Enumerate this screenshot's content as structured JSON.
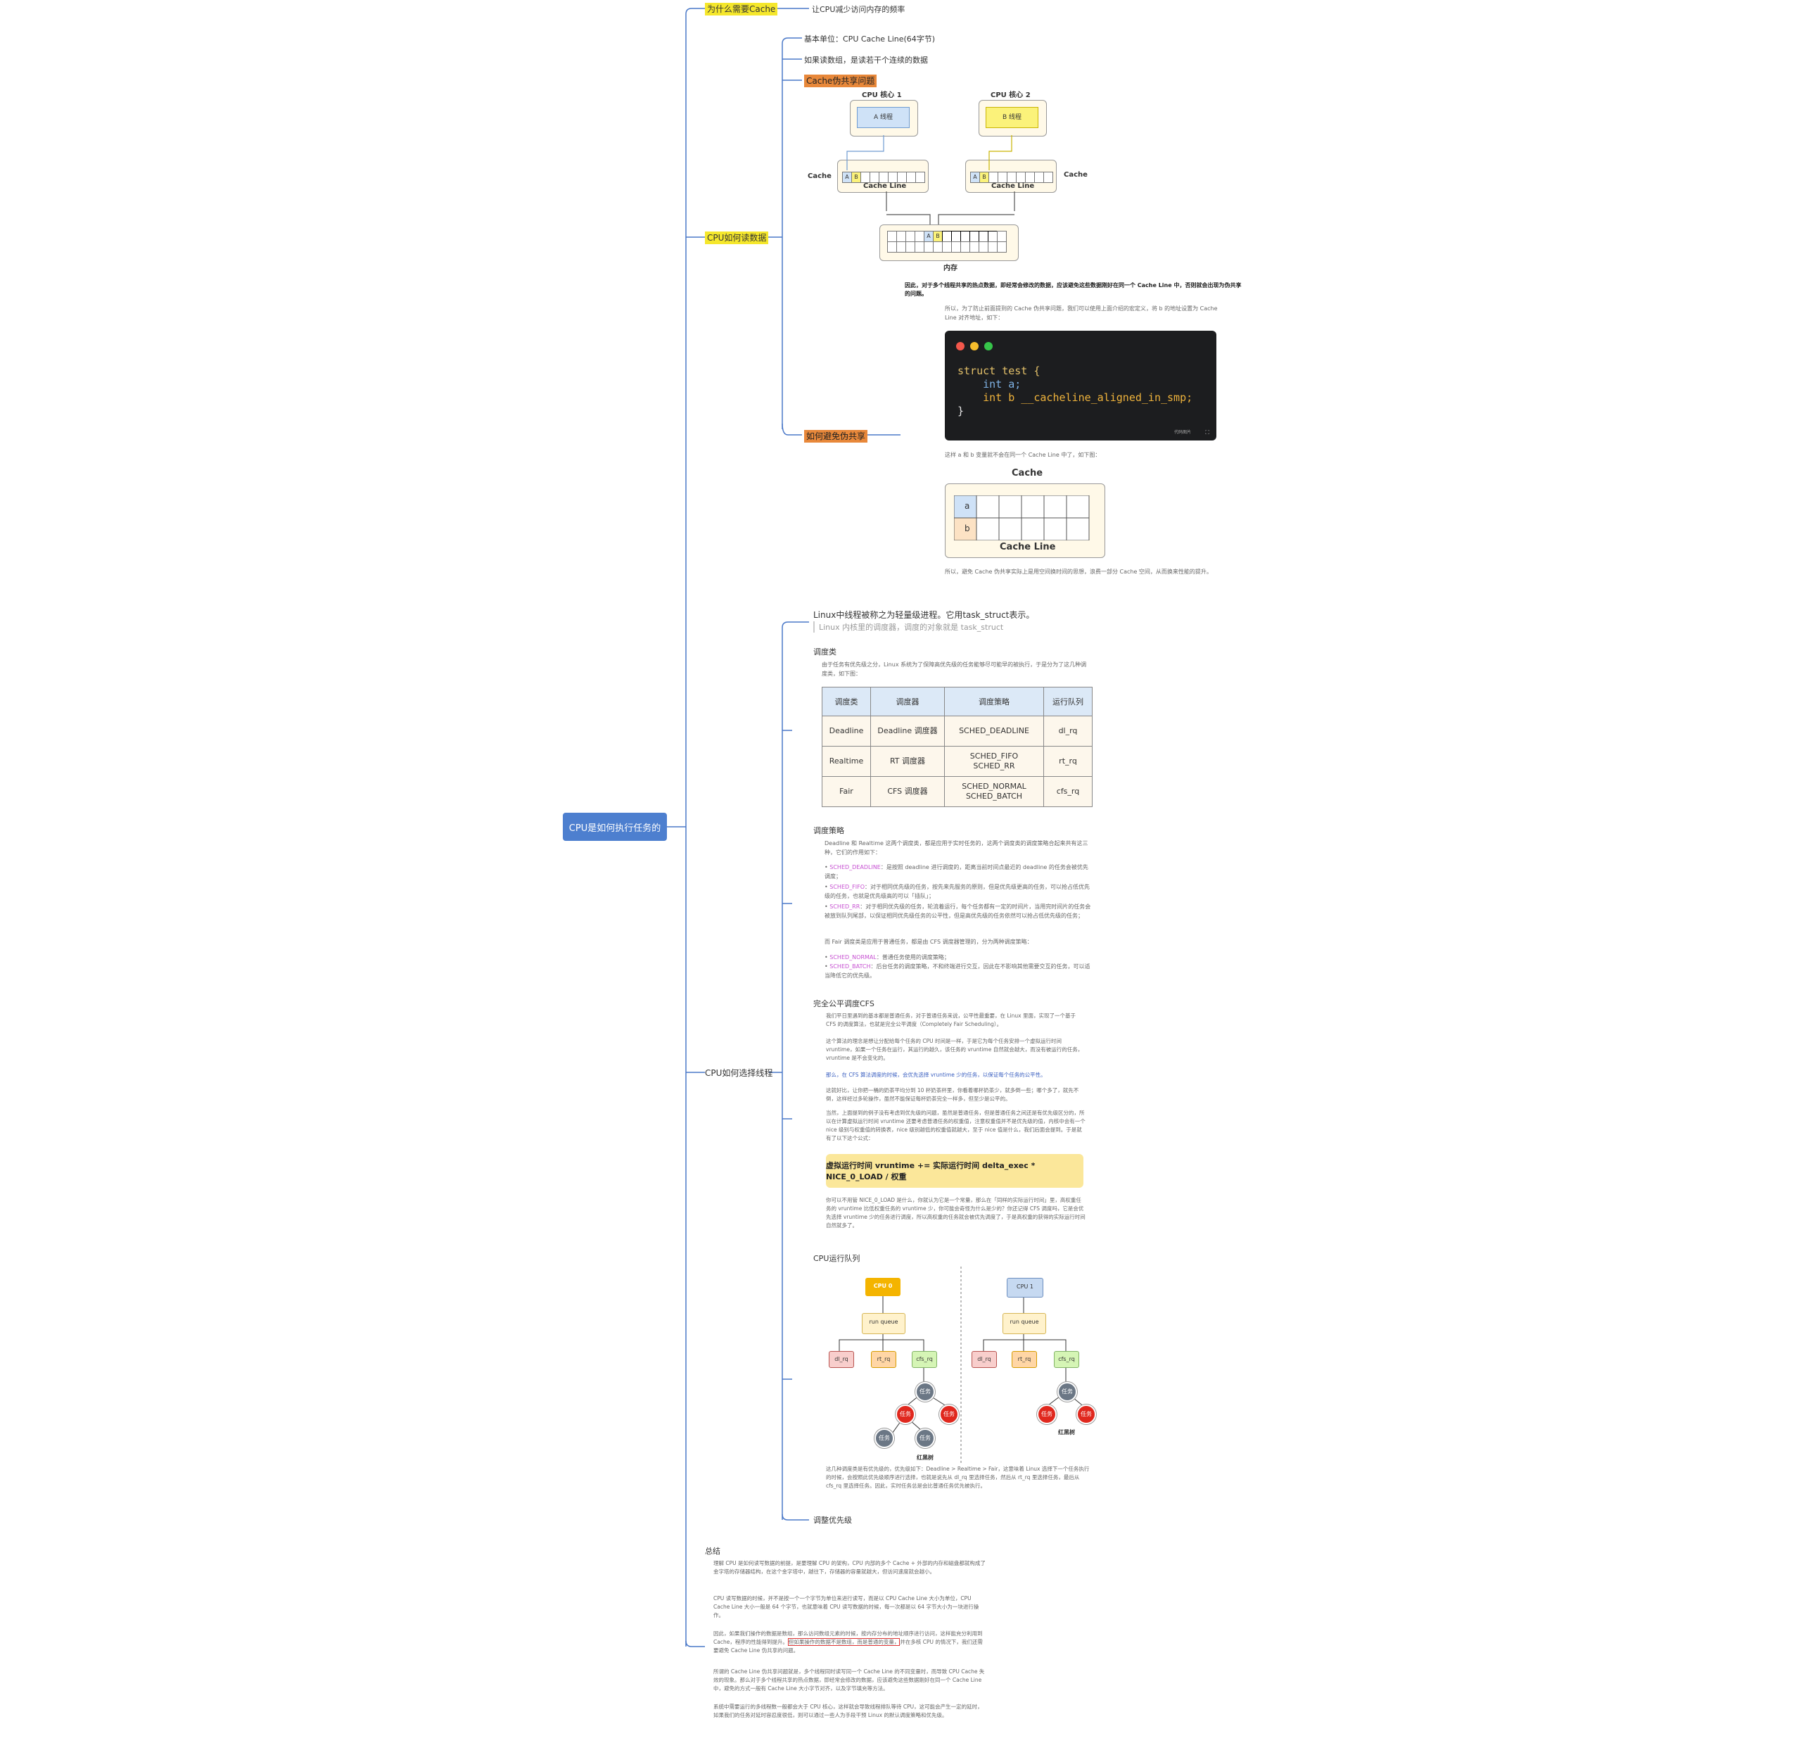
{
  "root": "CPU是如何执行任务的",
  "branch1": {
    "label": "为什么需要Cache",
    "child": "让CPU减少访问内存的频率"
  },
  "branch2": {
    "label": "CPU如何读数据",
    "items": [
      "基本单位：CPU Cache Line(64字节)",
      "如果读数组，是读若干个连续的数据"
    ],
    "false_sharing": "Cache伪共享问题",
    "diagram": {
      "core1": "CPU 核心 1",
      "core2": "CPU 核心 2",
      "threadA": "A 线程",
      "threadB": "B 线程",
      "cache": "Cache",
      "cache_line": "Cache Line",
      "memory": "内存",
      "cell_a": "A",
      "cell_b": "B"
    },
    "conclusion": "因此，对于多个线程共享的热点数据，即经常会修改的数据，应该避免这些数据刚好在同一个 Cache Line 中，否则就会出现为伪共享的问题。",
    "avoid": {
      "label": "如何避免伪共享",
      "intro": "所以，为了防止前面提到的 Cache 伪共享问题，我们可以使用上面介绍的宏定义，将 b 的地址设置为 Cache Line 对齐地址，如下：",
      "code_lines": [
        "struct test {",
        "    int a;",
        "    int b __cacheline_aligned_in_smp;",
        "}"
      ],
      "code_badge": "代码图片",
      "after": "这样 a 和 b 变量就不会在同一个 Cache Line 中了，如下图：",
      "cache_title": "Cache",
      "cell_a": "a",
      "cell_b": "b",
      "cache_line": "Cache Line",
      "footer": "所以，避免 Cache 伪共享实际上是用空间换时间的思想，浪费一部分 Cache 空间，从而换来性能的提升。"
    }
  },
  "branch3": {
    "label": "CPU如何选择线程",
    "thread_intro": "Linux中线程被称之为轻量级进程。它用task_struct表示。",
    "thread_quote": "Linux 内核里的调度器，调度的对象就是 task_struct",
    "sched_class": {
      "title": "调度类",
      "desc": "由于任务有优先级之分，Linux 系统为了保障高优先级的任务能够尽可能早的被执行，于是分为了这几种调度类，如下图：",
      "headers": [
        "调度类",
        "调度器",
        "调度策略",
        "运行队列"
      ],
      "rows": [
        [
          "Deadline",
          "Deadline 调度器",
          "SCHED_DEADLINE",
          "dl_rq"
        ],
        [
          "Realtime",
          "RT 调度器",
          "SCHED_FIFO\nSCHED_RR",
          "rt_rq"
        ],
        [
          "Fair",
          "CFS 调度器",
          "SCHED_NORMAL\nSCHED_BATCH",
          "cfs_rq"
        ]
      ]
    },
    "sched_policy": {
      "title": "调度策略",
      "desc": "Deadline 和 Realtime 这两个调度类，都是应用于实时任务的，这两个调度类的调度策略合起来共有这三种，它们的作用如下：",
      "items": [
        {
          "name": "SCHED_DEADLINE",
          "text": "：是按照 deadline 进行调度的，距离当前时间点最近的 deadline 的任务会被优先调度；"
        },
        {
          "name": "SCHED_FIFO",
          "text": "：对于相同优先级的任务，按先来先服务的原则，但是优先级更高的任务，可以抢占低优先级的任务，也就是优先级高的可以「插队」；"
        },
        {
          "name": "SCHED_RR",
          "text": "：对于相同优先级的任务，轮流着运行，每个任务都有一定的时间片，当用完时间片的任务会被放到队列尾部，以保证相同优先级任务的公平性，但是高优先级的任务依然可以抢占低优先级的任务；"
        }
      ],
      "fair_desc": "而 Fair 调度类是应用于普通任务，都是由 CFS 调度器管理的，分为两种调度策略：",
      "fair_items": [
        {
          "name": "SCHED_NORMAL",
          "text": "：普通任务使用的调度策略；"
        },
        {
          "name": "SCHED_BATCH",
          "text": "：后台任务的调度策略，不和终端进行交互，因此在不影响其他需要交互的任务，可以适当降低它的优先级。"
        }
      ]
    },
    "cfs": {
      "title": "完全公平调度CFS",
      "p1": "我们平日里遇到的基本都是普通任务，对于普通任务来说，公平性最重要，在 Linux 里面，实现了一个基于 CFS 的调度算法，也就是完全公平调度（Completely Fair Scheduling）。",
      "p2": "这个算法的理念是想让分配给每个任务的 CPU 时间是一样，于是它为每个任务安排一个虚拟运行时间 vruntime，如果一个任务在运行，其运行的越久，该任务的 vruntime 自然就会越大，而没有被运行的任务，vruntime 是不会变化的。",
      "p3": "那么，在 CFS 算法调度的时候，会优先选择 vruntime 少的任务，以保证每个任务的公平性。",
      "p4": "这就好比，让你把一桶的奶茶平均分到 10 杯奶茶杯里，你看着哪杯奶茶少，就多倒一些；哪个多了，就先不倒，这样经过多轮操作，虽然不能保证每杯奶茶完全一样多，但至少是公平的。",
      "p5": "当然，上面提到的例子没有考虑到优先级的问题，虽然是普通任务，但是普通任务之间还是有优先级区分的，所以在计算虚拟运行时间 vruntime 还要考虑普通任务的权重值，注意权重值并不是优先级的值，内核中会有一个 nice 级别与权重值的转换表，nice 级别越低的权重值就越大，至于 nice 值是什么，我们后面会提到。于是就有了以下这个公式：",
      "formula": "虚拟运行时间 vruntime += 实际运行时间 delta_exec * NICE_0_LOAD / 权重",
      "p6": "你可以不用管 NICE_0_LOAD 是什么，你就认为它是一个常量，那么在「同样的实际运行时间」里，高权重任务的 vruntime 比低权重任务的 vruntime 少，你可能会奇怪为什么是少的？你还记得 CFS 调度吗，它是会优先选择 vruntime 少的任务进行调度，所以高权重的任务就会被优先调度了，于是高权重的获得的实际运行时间自然就多了。"
    },
    "runqueue": {
      "title": "CPU运行队列",
      "cpu0": "CPU 0",
      "cpu1": "CPU 1",
      "rq": "run queue",
      "dl": "dl_rq",
      "rt": "rt_rq",
      "cfs": "cfs_rq",
      "task": "任务",
      "rbtree": "红黑树",
      "desc": "这几种调度类是有优先级的，优先级如下：Deadline > Realtime > Fair，这意味着 Linux 选择下一个任务执行的时候，会按照此优先级顺序进行选择，也就是说先从 dl_rq 里选择任务，然后从 rt_rq 里选择任务，最后从 cfs_rq 里选择任务。因此，实时任务总是会比普通任务优先被执行。"
    },
    "priority": "调整优先级"
  },
  "summary": {
    "title": "总结",
    "p1": "理解 CPU 是如何读写数据的前提，是要理解 CPU 的架构，CPU 内部的多个 Cache + 外部的内存和磁盘都就构成了金字塔的存储器结构，在这个金字塔中，越往下，存储器的容量就越大，但访问速度就会越小。",
    "p2": "CPU 读写数据的时候，并不是按一个一个字节为单位来进行读写，而是以 CPU Cache Line 大小为单位，CPU Cache Line 大小一般是 64 个字节，也就意味着 CPU 读写数据的时候，每一次都是以 64 字节大小为一块进行操作。",
    "p3a": "因此，如果我们操作的数据是数组，那么访问数组元素的时候，按内存分布的地址顺序进行访问，这样能充分利用到 Cache，程序的性能得到提升。",
    "p3b": "但如果操作的数据不是数组，而是普通的变量，",
    "p3c": "并在多核 CPU 的情况下，我们还需要避免 Cache Line 伪共享的问题。",
    "p4": "所谓的 Cache Line 伪共享问题就是，多个线程同时读写同一个 Cache Line 的不同变量时，而导致 CPU Cache 失效的现象。那么对于多个线程共享的热点数据，即经常会修改的数据，应该避免这些数据刚好在同一个 Cache Line 中，避免的方式一般有 Cache Line 大小字节对齐，以及字节填充等方法。",
    "p5": "系统中需要运行的多线程数一般都会大于 CPU 核心，这样就会导致线程排队等待 CPU，这可能会产生一定的延时，如果我们的任务对延时容忍度很低，则可以通过一些人为手段干预 Linux 的默认调度策略和优先级。"
  },
  "colors": {
    "root_bg": "#4d7fcf",
    "line": "#4a78c8",
    "highlight_yellow": "#f5e72c",
    "highlight_orange": "#e8883a",
    "policy_name": "#c64fd1"
  }
}
